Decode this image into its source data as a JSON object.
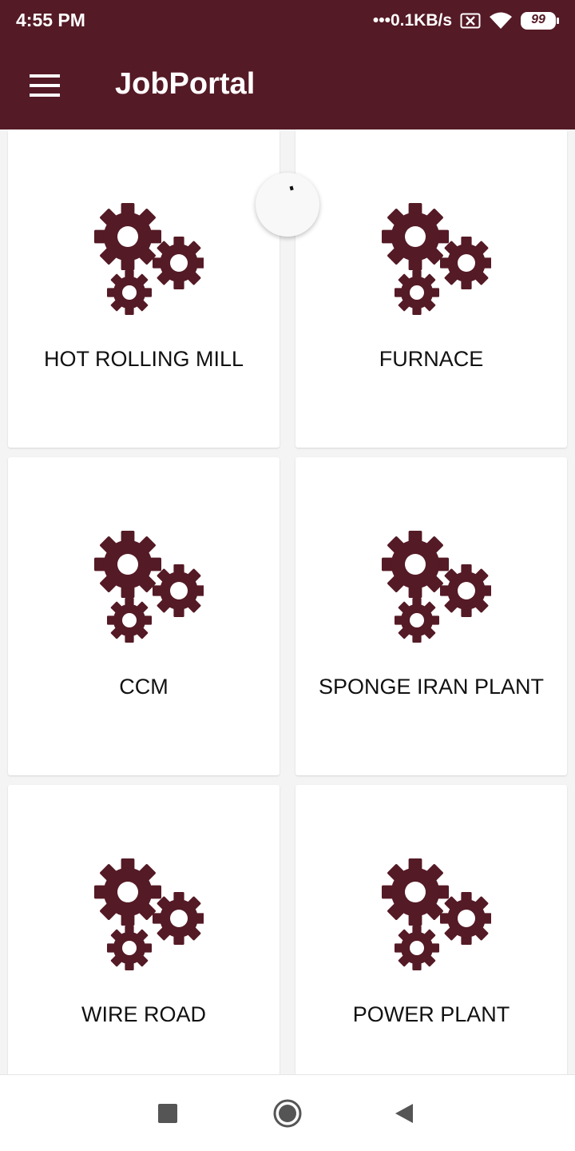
{
  "status_bar": {
    "time": "4:55 PM",
    "network_speed": "•••0.1KB/s",
    "battery": "99",
    "icons": [
      "sim-x-icon",
      "wifi-icon",
      "battery-icon"
    ]
  },
  "app_bar": {
    "title": "JobPortal",
    "menu_icon": "hamburger-menu-icon"
  },
  "categories": [
    {
      "label": "HOT ROLLING MILL",
      "icon": "gears-icon"
    },
    {
      "label": "FURNACE",
      "icon": "gears-icon"
    },
    {
      "label": "CCM",
      "icon": "gears-icon"
    },
    {
      "label": "SPONGE IRAN PLANT",
      "icon": "gears-icon"
    },
    {
      "label": "WIRE ROAD",
      "icon": "gears-icon"
    },
    {
      "label": "POWER PLANT",
      "icon": "gears-icon"
    }
  ],
  "nav_bar": {
    "buttons": [
      "recents-square-icon",
      "home-circle-icon",
      "back-triangle-icon"
    ]
  },
  "colors": {
    "primary": "#541a25",
    "icon": "#541a25",
    "background": "#f4f4f4",
    "card": "#ffffff"
  }
}
